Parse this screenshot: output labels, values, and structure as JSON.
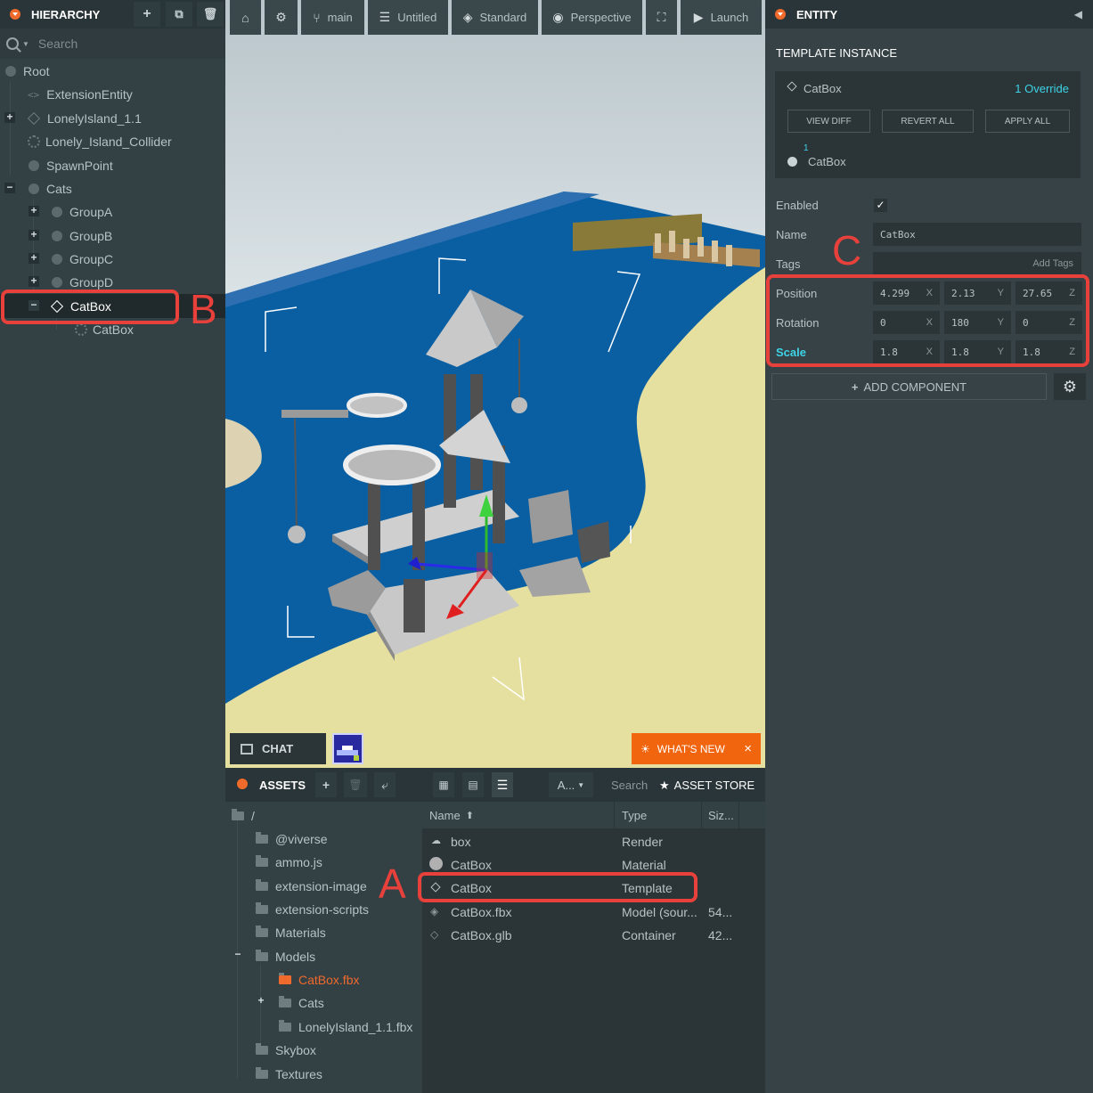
{
  "hierarchy": {
    "title": "HIERARCHY",
    "search_placeholder": "Search",
    "items": [
      {
        "label": "Root"
      },
      {
        "label": "ExtensionEntity"
      },
      {
        "label": "LonelyIsland_1.1"
      },
      {
        "label": "Lonely_Island_Collider"
      },
      {
        "label": "SpawnPoint"
      },
      {
        "label": "Cats"
      },
      {
        "label": "GroupA"
      },
      {
        "label": "GroupB"
      },
      {
        "label": "GroupC"
      },
      {
        "label": "GroupD"
      },
      {
        "label": "CatBox"
      },
      {
        "label": "CatBox"
      }
    ]
  },
  "annotations": {
    "a": "A",
    "b": "B",
    "c": "C"
  },
  "toolbar": {
    "branch": "main",
    "checkpoint": "Untitled",
    "render_mode": "Standard",
    "camera": "Perspective",
    "launch": "Launch"
  },
  "viewport_footer": {
    "chat": "CHAT",
    "whats_new": "WHAT'S NEW",
    "close": "×"
  },
  "entity": {
    "title": "ENTITY",
    "template_instance": {
      "heading": "TEMPLATE INSTANCE",
      "name": "CatBox",
      "override": "1 Override",
      "view_diff": "VIEW DIFF",
      "revert_all": "REVERT ALL",
      "apply_all": "APPLY ALL",
      "override_count": "1",
      "override_item": "CatBox"
    },
    "enabled_label": "Enabled",
    "enabled": true,
    "name_label": "Name",
    "name_value": "CatBox",
    "tags_label": "Tags",
    "add_tags": "Add Tags",
    "position_label": "Position",
    "position": {
      "x": "4.299",
      "y": "2.13",
      "z": "27.65"
    },
    "rotation_label": "Rotation",
    "rotation": {
      "x": "0",
      "y": "180",
      "z": "0"
    },
    "scale_label": "Scale",
    "scale": {
      "x": "1.8",
      "y": "1.8",
      "z": "1.8"
    },
    "axis_x": "X",
    "axis_y": "Y",
    "axis_z": "Z",
    "add_component": "ADD COMPONENT"
  },
  "assets": {
    "title": "ASSETS",
    "filter": "A...",
    "search": "Search",
    "asset_store": "ASSET STORE",
    "folders": [
      {
        "label": "/"
      },
      {
        "label": "@viverse"
      },
      {
        "label": "ammo.js"
      },
      {
        "label": "extension-image"
      },
      {
        "label": "extension-scripts"
      },
      {
        "label": "Materials"
      },
      {
        "label": "Models"
      },
      {
        "label": "CatBox.fbx"
      },
      {
        "label": "Cats"
      },
      {
        "label": "LonelyIsland_1.1.fbx"
      },
      {
        "label": "Skybox"
      },
      {
        "label": "Textures"
      }
    ],
    "columns": {
      "name": "Name",
      "type": "Type",
      "size": "Siz..."
    },
    "files": [
      {
        "name": "box",
        "type": "Render",
        "size": ""
      },
      {
        "name": "CatBox",
        "type": "Material",
        "size": ""
      },
      {
        "name": "CatBox",
        "type": "Template",
        "size": ""
      },
      {
        "name": "CatBox.fbx",
        "type": "Model (sour...",
        "size": "54..."
      },
      {
        "name": "CatBox.glb",
        "type": "Container",
        "size": "42..."
      }
    ]
  },
  "colors": {
    "accent": "#f06a2c",
    "annotation": "#e8413b",
    "cyan": "#3ed3e6"
  }
}
